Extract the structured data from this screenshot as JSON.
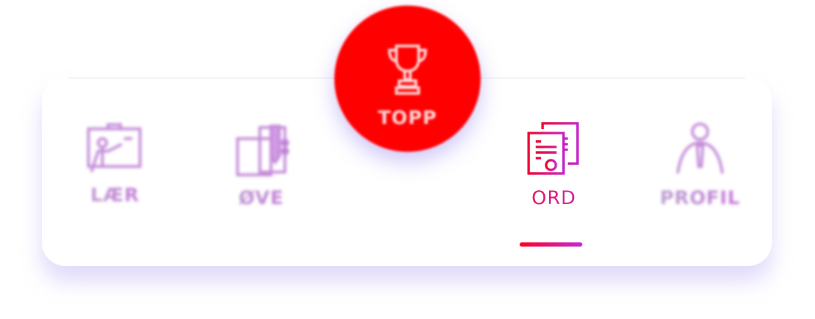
{
  "nav": {
    "items": [
      {
        "label": "LÆR",
        "icon": "teacher-board-icon",
        "active": false
      },
      {
        "label": "ØVE",
        "icon": "notebook-pen-icon",
        "active": false
      },
      {
        "label": "ORD",
        "icon": "documents-icon",
        "active": true
      },
      {
        "label": "PROFIL",
        "icon": "person-icon",
        "active": false
      }
    ],
    "center": {
      "label": "TOPP",
      "icon": "trophy-icon"
    }
  },
  "colors": {
    "fab": "#ff0000",
    "active_start": "#f0002f",
    "active_end": "#c324c8",
    "inactive": "#c080dc"
  }
}
